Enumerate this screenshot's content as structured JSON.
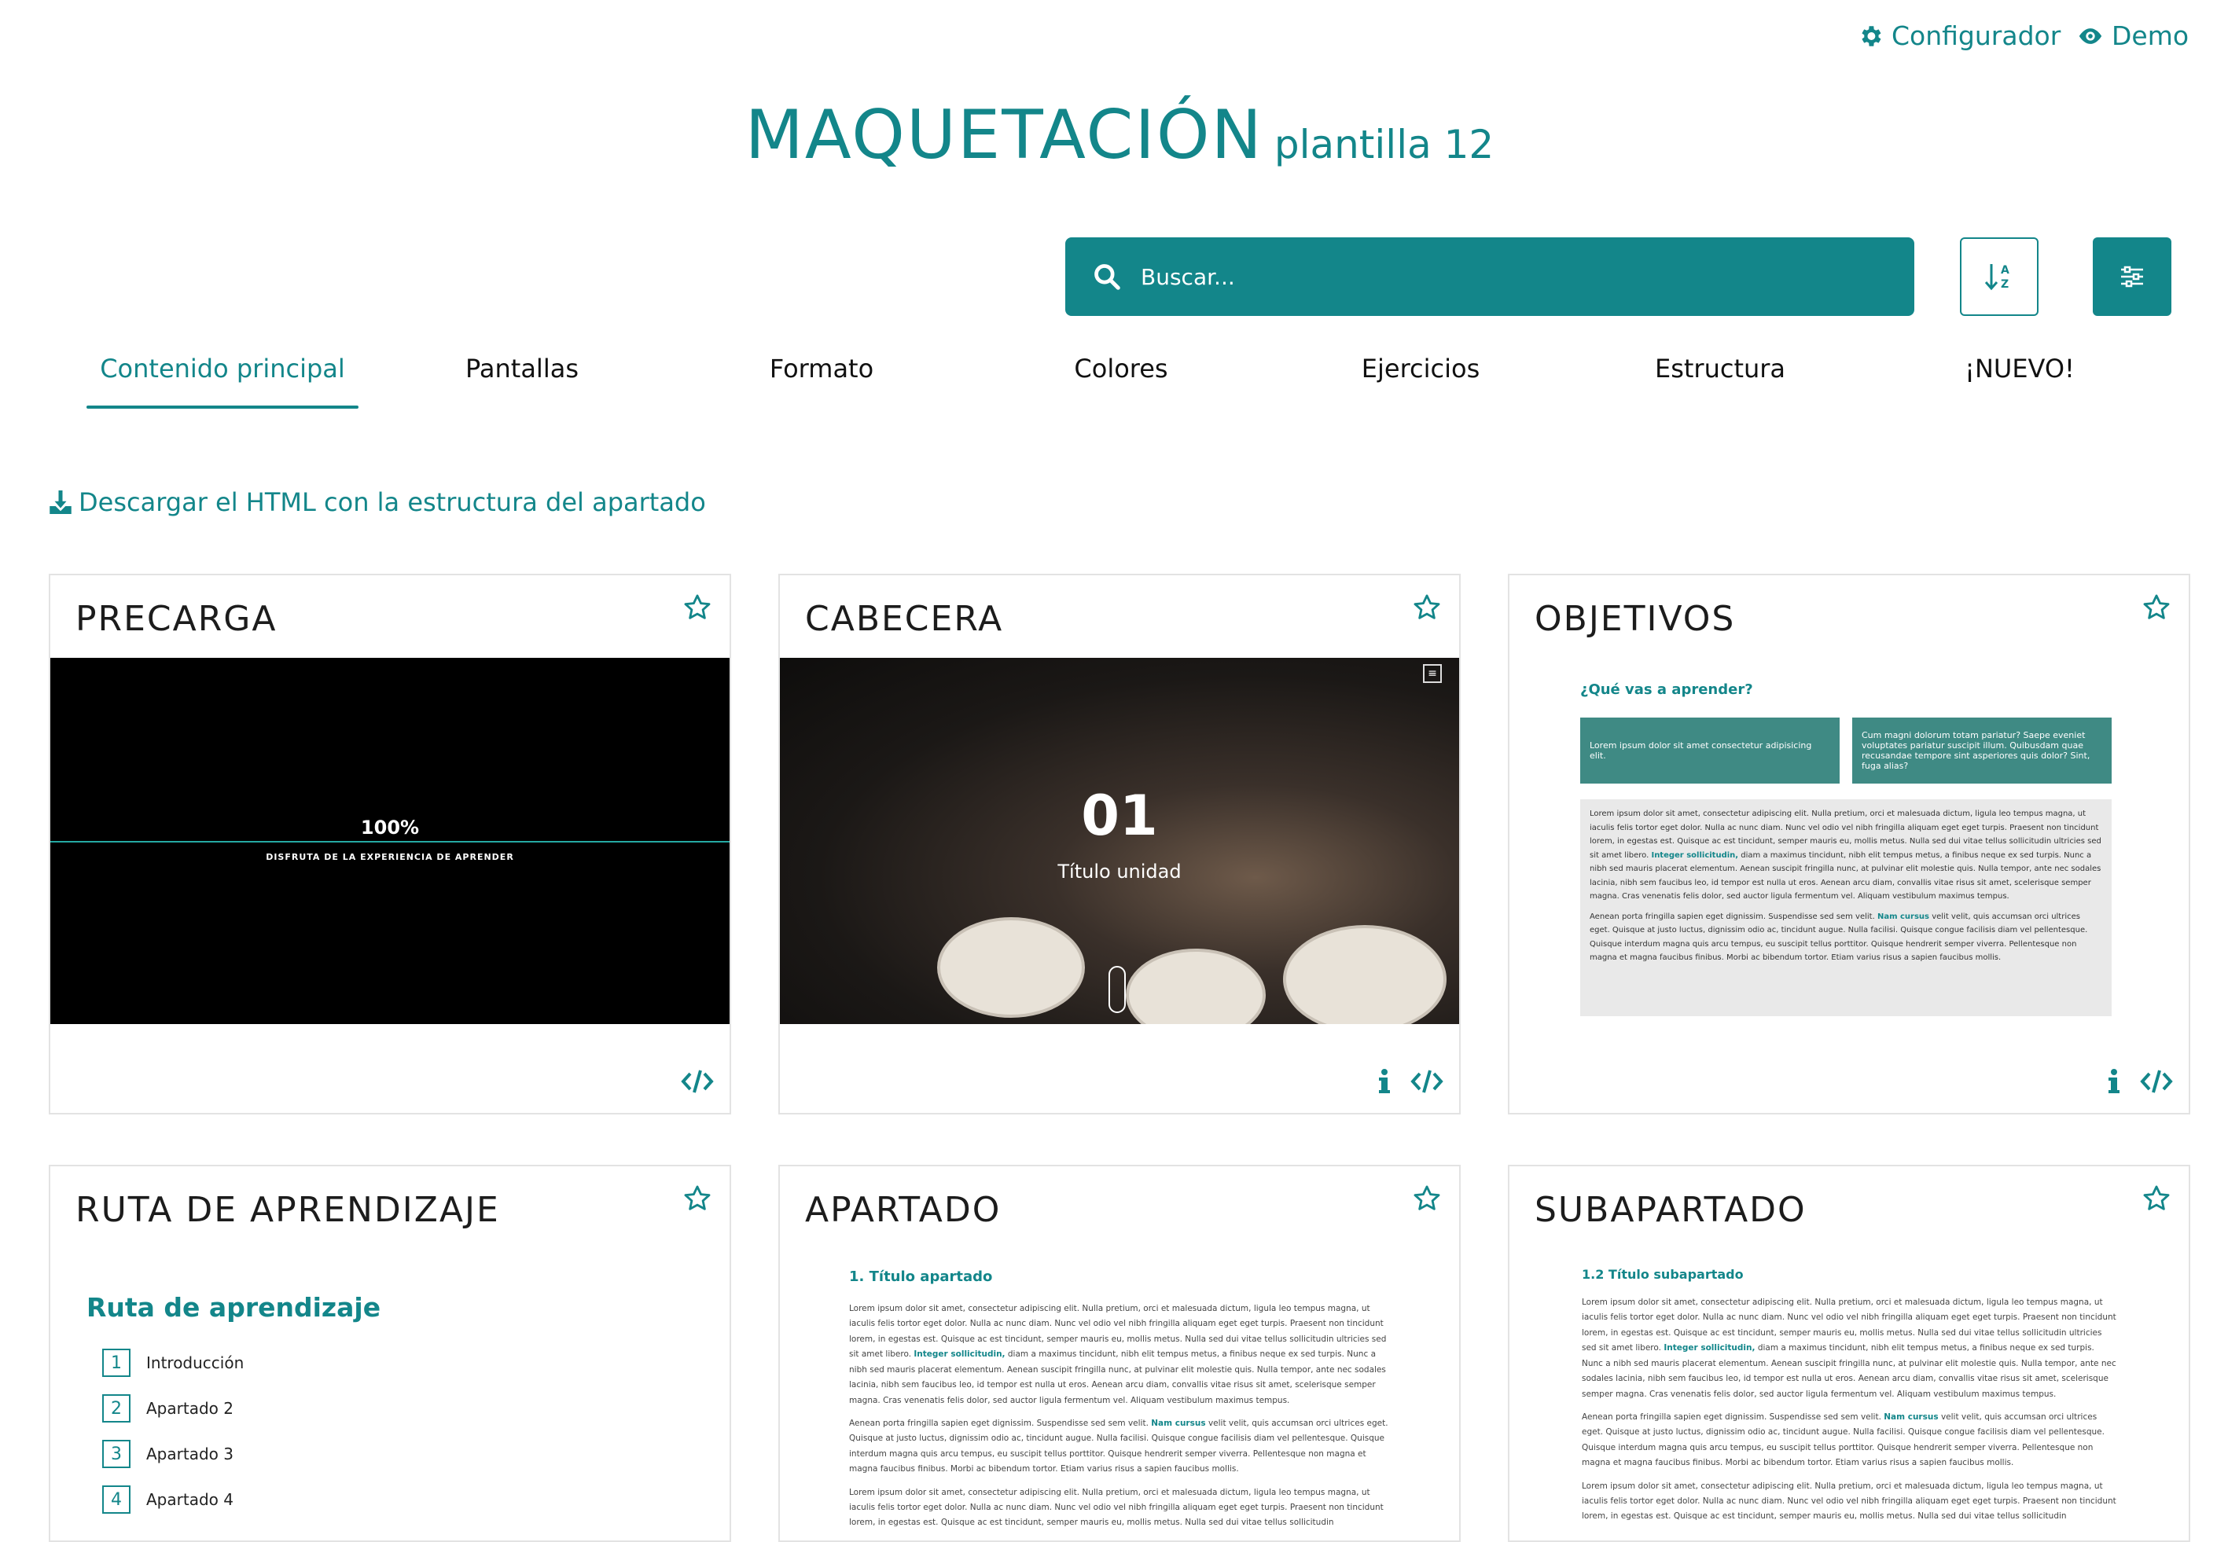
{
  "colors": {
    "accent": "#13868a",
    "card_border": "#e3e3e3",
    "text": "#1c1c1c"
  },
  "toplinks": {
    "configurador": "Configurador",
    "demo": "Demo"
  },
  "header": {
    "title": "MAQUETACIÓN",
    "subtitle": "plantilla 12"
  },
  "search": {
    "placeholder": "Buscar..."
  },
  "tabs": [
    "Contenido principal",
    "Pantallas",
    "Formato",
    "Colores",
    "Ejercicios",
    "Estructura",
    "¡NUEVO!"
  ],
  "active_tab": "Contenido principal",
  "download": {
    "label": "Descargar el HTML con la estructura del apartado"
  },
  "cards": {
    "precarga": {
      "title": "PRECARGA",
      "percent": "100%",
      "tagline": "DISFRUTA DE LA EXPERIENCIA DE APRENDER"
    },
    "cabecera": {
      "title": "CABECERA",
      "number": "01",
      "subtitle": "Título unidad"
    },
    "objetivos": {
      "title": "OBJETIVOS",
      "question": "¿Qué vas a aprender?",
      "box1": "Lorem ipsum dolor sit amet consectetur adipisicing elit.",
      "box2": "Cum magni dolorum totam pariatur? Saepe eveniet voluptates pariatur suscipit illum. Quibusdam quae recusandae tempore sint asperiores quis dolor? Sint, fuga alias?",
      "para1_a": "Lorem ipsum dolor sit amet, consectetur adipiscing elit. Nulla pretium, orci et malesuada dictum, ligula leo tempus magna, ut iaculis felis tortor eget dolor. Nulla ac nunc diam. Nunc vel odio vel nibh fringilla aliquam eget eget turpis. Praesent non tincidunt lorem, in egestas est. Quisque ac est tincidunt, semper mauris eu, mollis metus. Nulla sed dui vitae tellus sollicitudin ultricies sed sit amet libero.",
      "para1_link": "Integer sollicitudin,",
      "para1_b": "diam a maximus tincidunt, nibh elit tempus metus, a finibus neque ex sed turpis. Nunc a nibh sed mauris placerat elementum. Aenean suscipit fringilla nunc, at pulvinar elit molestie quis. Nulla tempor, ante nec sodales lacinia, nibh sem faucibus leo, id tempor est nulla ut eros. Aenean arcu diam, convallis vitae risus sit amet, scelerisque semper magna. Cras venenatis felis dolor, sed auctor ligula fermentum vel. Aliquam vestibulum maximus tempus.",
      "para2_a": "Aenean porta fringilla sapien eget dignissim. Suspendisse sed sem velit.",
      "para2_link": "Nam cursus",
      "para2_b": "velit velit, quis accumsan orci ultrices eget. Quisque at justo luctus, dignissim odio ac, tincidunt augue. Nulla facilisi. Quisque congue facilisis diam vel pellentesque. Quisque interdum magna quis arcu tempus, eu suscipit tellus porttitor. Quisque hendrerit semper viverra. Pellentesque non magna et magna faucibus finibus. Morbi ac bibendum tortor. Etiam varius risus a sapien faucibus mollis."
    },
    "ruta": {
      "title": "RUTA DE APRENDIZAJE",
      "heading": "Ruta de aprendizaje",
      "items": [
        {
          "num": "1",
          "label": "Introducción"
        },
        {
          "num": "2",
          "label": "Apartado 2"
        },
        {
          "num": "3",
          "label": "Apartado 3"
        },
        {
          "num": "4",
          "label": "Apartado 4"
        }
      ]
    },
    "apartado": {
      "title": "APARTADO",
      "heading": "1. Título apartado",
      "para1_a": "Lorem ipsum dolor sit amet, consectetur adipiscing elit. Nulla pretium, orci et malesuada dictum, ligula leo tempus magna, ut iaculis felis tortor eget dolor. Nulla ac nunc diam. Nunc vel odio vel nibh fringilla aliquam eget eget turpis. Praesent non tincidunt lorem, in egestas est. Quisque ac est tincidunt, semper mauris eu, mollis metus. Nulla sed dui vitae tellus sollicitudin ultricies sed sit amet libero.",
      "para1_link": "Integer sollicitudin,",
      "para1_b": "diam a maximus tincidunt, nibh elit tempus metus, a finibus neque ex sed turpis. Nunc a nibh sed mauris placerat elementum. Aenean suscipit fringilla nunc, at pulvinar elit molestie quis. Nulla tempor, ante nec sodales lacinia, nibh sem faucibus leo, id tempor est nulla ut eros. Aenean arcu diam, convallis vitae risus sit amet, scelerisque semper magna. Cras venenatis felis dolor, sed auctor ligula fermentum vel. Aliquam vestibulum maximus tempus.",
      "para2_a": "Aenean porta fringilla sapien eget dignissim. Suspendisse sed sem velit.",
      "para2_link": "Nam cursus",
      "para2_b": "velit velit, quis accumsan orci ultrices eget. Quisque at justo luctus, dignissim odio ac, tincidunt augue. Nulla facilisi. Quisque congue facilisis diam vel pellentesque. Quisque interdum magna quis arcu tempus, eu suscipit tellus porttitor. Quisque hendrerit semper viverra. Pellentesque non magna et magna faucibus finibus. Morbi ac bibendum tortor. Etiam varius risus a sapien faucibus mollis.",
      "para3": "Lorem ipsum dolor sit amet, consectetur adipiscing elit. Nulla pretium, orci et malesuada dictum, ligula leo tempus magna, ut iaculis felis tortor eget dolor. Nulla ac nunc diam. Nunc vel odio vel nibh fringilla aliquam eget eget turpis. Praesent non tincidunt lorem, in egestas est. Quisque ac est tincidunt, semper mauris eu, mollis metus. Nulla sed dui vitae tellus sollicitudin"
    },
    "subapartado": {
      "title": "SUBAPARTADO",
      "heading": "1.2 Título subapartado",
      "para1_a": "Lorem ipsum dolor sit amet, consectetur adipiscing elit. Nulla pretium, orci et malesuada dictum, ligula leo tempus magna, ut iaculis felis tortor eget dolor. Nulla ac nunc diam. Nunc vel odio vel nibh fringilla aliquam eget eget turpis. Praesent non tincidunt lorem, in egestas est. Quisque ac est tincidunt, semper mauris eu, mollis metus. Nulla sed dui vitae tellus sollicitudin ultricies sed sit amet libero.",
      "para1_link": "Integer sollicitudin,",
      "para1_b": "diam a maximus tincidunt, nibh elit tempus metus, a finibus neque ex sed turpis. Nunc a nibh sed mauris placerat elementum. Aenean suscipit fringilla nunc, at pulvinar elit molestie quis. Nulla tempor, ante nec sodales lacinia, nibh sem faucibus leo, id tempor est nulla ut eros. Aenean arcu diam, convallis vitae risus sit amet, scelerisque semper magna. Cras venenatis felis dolor, sed auctor ligula fermentum vel. Aliquam vestibulum maximus tempus.",
      "para2_a": "Aenean porta fringilla sapien eget dignissim. Suspendisse sed sem velit.",
      "para2_link": "Nam cursus",
      "para2_b": "velit velit, quis accumsan orci ultrices eget. Quisque at justo luctus, dignissim odio ac, tincidunt augue. Nulla facilisi. Quisque congue facilisis diam vel pellentesque. Quisque interdum magna quis arcu tempus, eu suscipit tellus porttitor. Quisque hendrerit semper viverra. Pellentesque non magna et magna faucibus finibus. Morbi ac bibendum tortor. Etiam varius risus a sapien faucibus mollis.",
      "para3": "Lorem ipsum dolor sit amet, consectetur adipiscing elit. Nulla pretium, orci et malesuada dictum, ligula leo tempus magna, ut iaculis felis tortor eget dolor. Nulla ac nunc diam. Nunc vel odio vel nibh fringilla aliquam eget eget turpis. Praesent non tincidunt lorem, in egestas est. Quisque ac est tincidunt, semper mauris eu, mollis metus. Nulla sed dui vitae tellus sollicitudin"
    }
  },
  "icons": {
    "configurador": "gear-icon",
    "demo": "eye-icon",
    "search": "search-icon",
    "sort": "sort-alpha-icon",
    "filter": "sliders-icon",
    "download": "download-icon",
    "favorite": "star-icon",
    "info": "info-icon",
    "code": "code-icon"
  }
}
